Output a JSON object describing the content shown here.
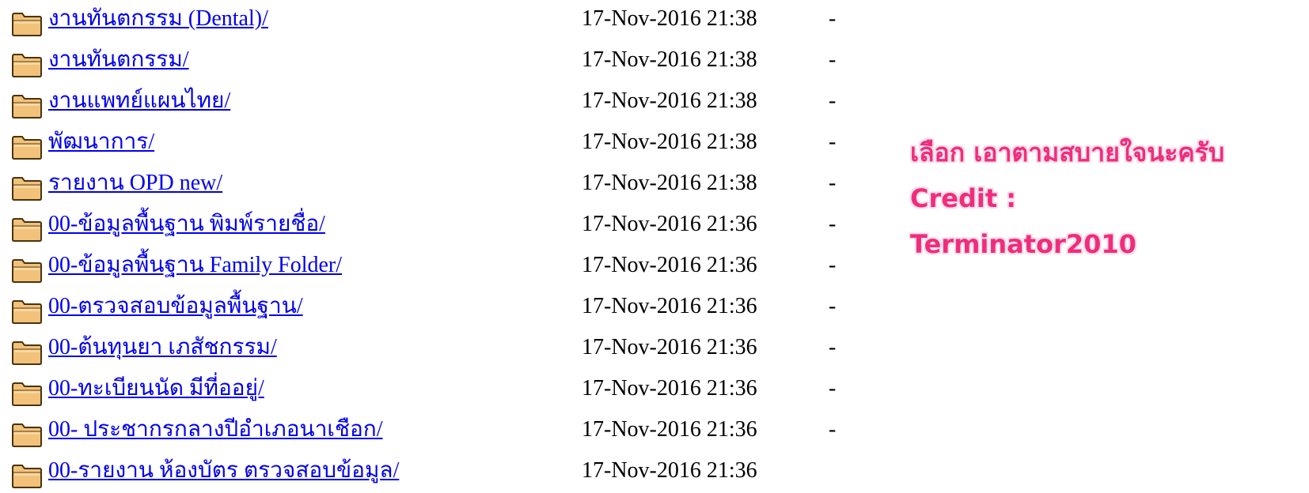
{
  "colors": {
    "link": "#0000ee",
    "note_text": "#f02d7d",
    "folder_fill": "#f2c27a",
    "folder_outline": "#4a3310"
  },
  "listing": {
    "icon": "folder-icon",
    "rows": [
      {
        "name": "งานทันตกรรม (Dental)/",
        "date": "17-Nov-2016 21:38",
        "size": "-"
      },
      {
        "name": "งานทันตกรรม/",
        "date": "17-Nov-2016 21:38",
        "size": "-"
      },
      {
        "name": "งานแพทย์แผนไทย/",
        "date": "17-Nov-2016 21:38",
        "size": "-"
      },
      {
        "name": "พัฒนาการ/",
        "date": "17-Nov-2016 21:38",
        "size": "-"
      },
      {
        "name": "รายงาน OPD new/",
        "date": "17-Nov-2016 21:38",
        "size": "-"
      },
      {
        "name": "00-ข้อมูลพื้นฐาน พิมพ์รายชื่อ/",
        "date": "17-Nov-2016 21:36",
        "size": "-"
      },
      {
        "name": "00-ข้อมูลพื้นฐาน Family Folder/",
        "date": "17-Nov-2016 21:36",
        "size": "-"
      },
      {
        "name": "00-ตรวจสอบข้อมูลพื้นฐาน/",
        "date": "17-Nov-2016 21:36",
        "size": "-"
      },
      {
        "name": "00-ต้นทุนยา เภสัชกรรม/",
        "date": "17-Nov-2016 21:36",
        "size": "-"
      },
      {
        "name": "00-ทะเบียนนัด มีที่ออยู่/",
        "date": "17-Nov-2016 21:36",
        "size": "-"
      },
      {
        "name": "00- ประชากรกลางปีอำเภอนาเชือก/",
        "date": "17-Nov-2016 21:36",
        "size": "-"
      },
      {
        "name": "00-รายงาน ห้องบัตร ตรวจสอบข้อมูล/",
        "date": "17-Nov-2016 21:36",
        "size": ""
      }
    ]
  },
  "note": {
    "line1": "เลือก เอาตามสบายใจนะครับ",
    "line2": "Credit :",
    "line3": "Terminator2010"
  }
}
